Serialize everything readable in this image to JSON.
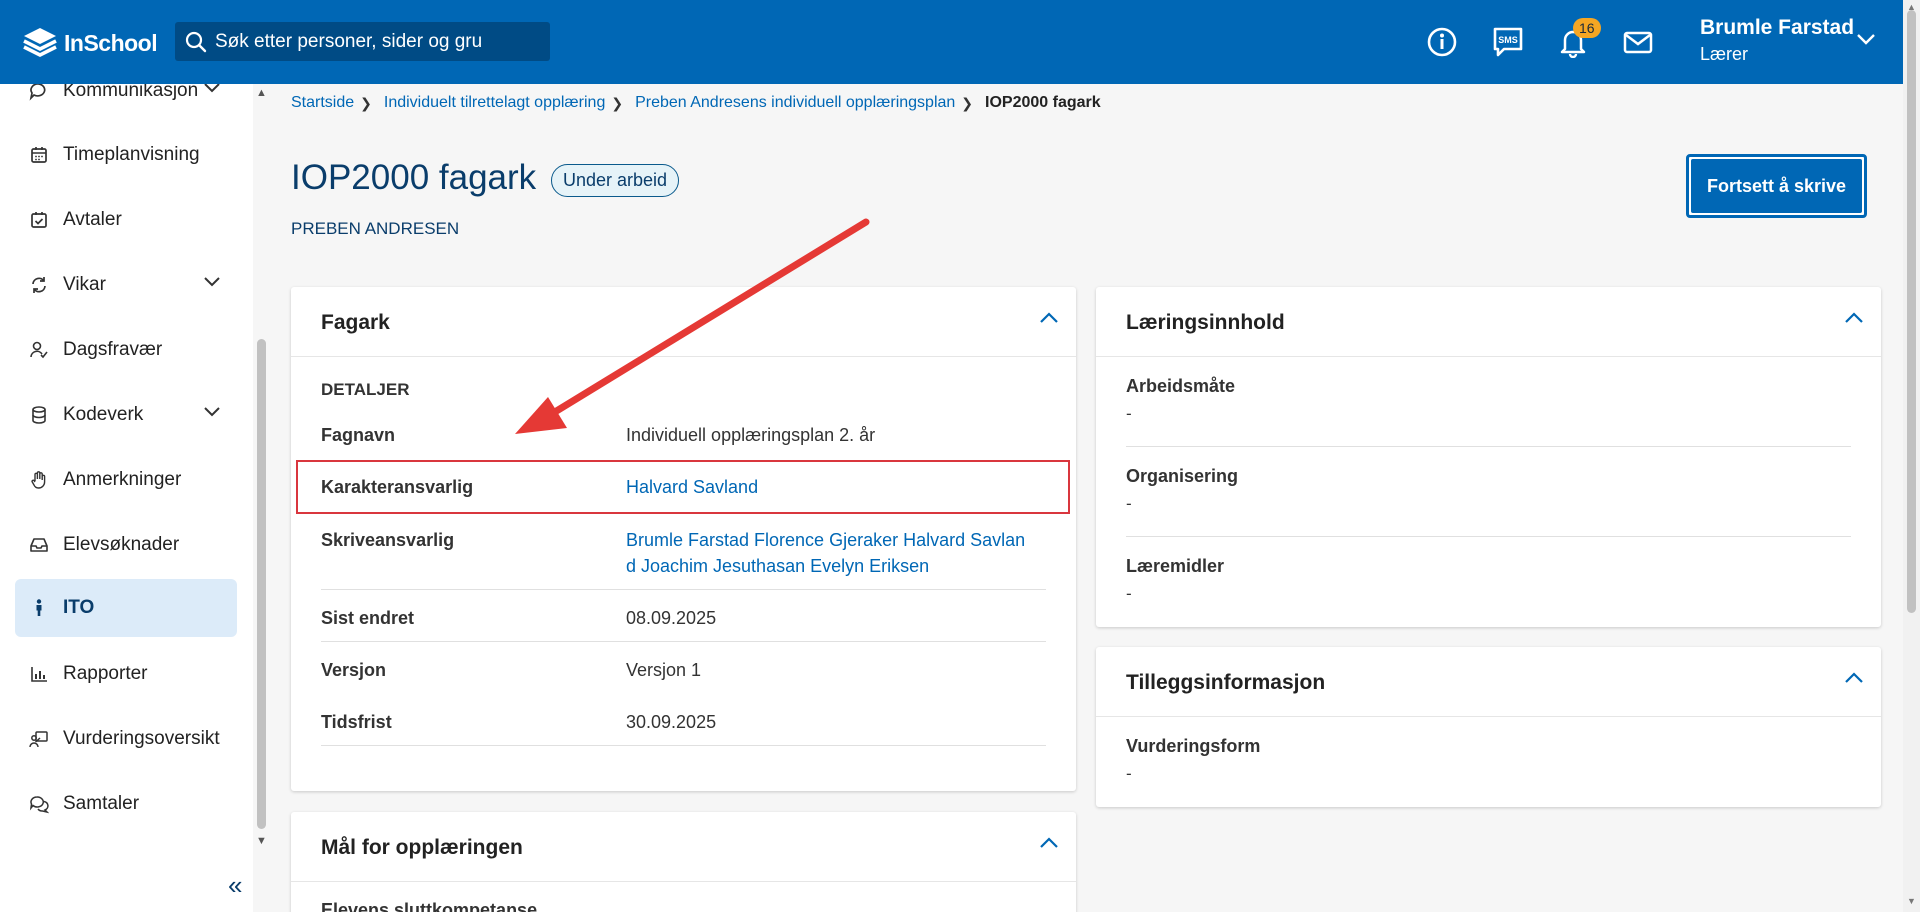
{
  "header": {
    "logo_text": "InSchool",
    "search_placeholder": "Søk etter personer, sider og gru",
    "notification_count": "16",
    "user_name": "Brumle Farstad",
    "user_role": "Lærer"
  },
  "sidebar": {
    "items": [
      {
        "label": "Kommunikasjon"
      },
      {
        "label": "Timeplanvisning"
      },
      {
        "label": "Avtaler"
      },
      {
        "label": "Vikar"
      },
      {
        "label": "Dagsfravær"
      },
      {
        "label": "Kodeverk"
      },
      {
        "label": "Anmerkninger"
      },
      {
        "label": "Elevsøknader"
      },
      {
        "label": "ITO"
      },
      {
        "label": "Rapporter"
      },
      {
        "label": "Vurderingsoversikt"
      },
      {
        "label": "Samtaler"
      }
    ],
    "collapse_symbol": "«"
  },
  "breadcrumb": {
    "items": [
      "Startside",
      "Individuelt tilrettelagt opplæring",
      "Preben Andresens individuell opplæringsplan"
    ],
    "current": "IOP2000 fagark"
  },
  "page": {
    "title": "IOP2000 fagark",
    "status": "Under arbeid",
    "student": "PREBEN ANDRESEN",
    "primary_button": "Fortsett å skrive"
  },
  "fagark": {
    "title": "Fagark",
    "details_heading": "DETALJER",
    "rows": [
      {
        "label": "Fagnavn",
        "value": "Individuell opplæringsplan 2. år"
      },
      {
        "label": "Karakteransvarlig",
        "value": "Halvard Savland"
      },
      {
        "label": "Skriveansvarlig",
        "value_line1": "Brumle Farstad Florence Gjeraker Halvard Savlan",
        "value_line2": "d Joachim Jesuthasan Evelyn Eriksen"
      },
      {
        "label": "Sist endret",
        "value": "08.09.2025"
      },
      {
        "label": "Versjon",
        "value": "Versjon 1"
      },
      {
        "label": "Tidsfrist",
        "value": "30.09.2025"
      }
    ]
  },
  "laeringsinnhold": {
    "title": "Læringsinnhold",
    "sections": [
      {
        "label": "Arbeidsmåte",
        "value": "-"
      },
      {
        "label": "Organisering",
        "value": "-"
      },
      {
        "label": "Læremidler",
        "value": "-"
      }
    ]
  },
  "tilleggsinformasjon": {
    "title": "Tilleggsinformasjon",
    "sections": [
      {
        "label": "Vurderingsform",
        "value": "-"
      }
    ]
  },
  "maal": {
    "title": "Mål for opplæringen",
    "first_label": "Elevens sluttkompetanse"
  },
  "colors": {
    "header": "#0067b5",
    "link": "#0067b5",
    "title": "#0a3d6b",
    "highlight": "#d9363e",
    "badge": "#f5a623"
  }
}
